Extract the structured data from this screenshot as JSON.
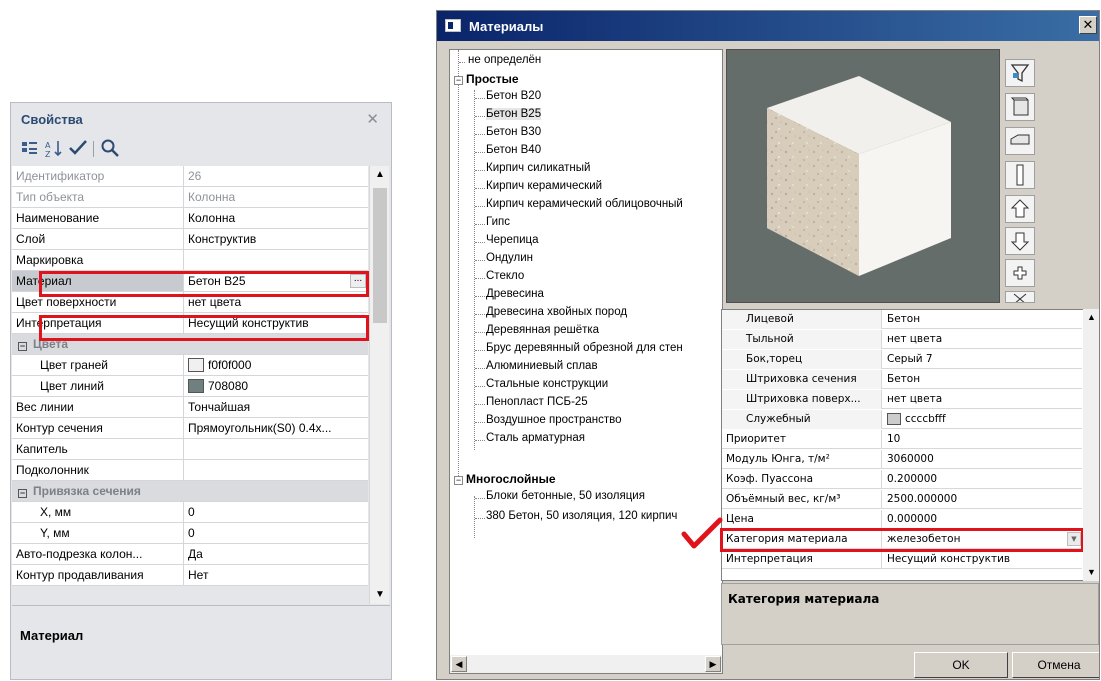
{
  "properties": {
    "title": "Свойства",
    "rows": [
      {
        "name": "Идентификатор",
        "value": "26"
      },
      {
        "name": "Тип объекта",
        "value": "Колонна"
      },
      {
        "name": "Наименование",
        "value": "Колонна"
      },
      {
        "name": "Слой",
        "value": "Конструктив"
      },
      {
        "name": "Маркировка",
        "value": ""
      },
      {
        "name": "Материал",
        "value": "Бетон В25",
        "button": "..."
      },
      {
        "name": "Цвет поверхности",
        "value": "нет цвета"
      },
      {
        "name": "Интерпретация",
        "value": "Несущий конструктив"
      },
      {
        "name": "Цвета",
        "value": "",
        "collapse": "−"
      },
      {
        "name": "Цвет граней",
        "value": "f0f0f000",
        "swatch": "#f0f0f0"
      },
      {
        "name": "Цвет линий",
        "value": "708080",
        "swatch": "#708080"
      },
      {
        "name": "Вес линии",
        "value": "Тончайшая"
      },
      {
        "name": "Контур сечения",
        "value": "Прямоугольник(S0) 0.4x..."
      },
      {
        "name": "Капитель",
        "value": ""
      },
      {
        "name": "Подколонник",
        "value": ""
      },
      {
        "name": "Привязка сечения",
        "value": "",
        "collapse": "−"
      },
      {
        "name": "X, мм",
        "value": "0"
      },
      {
        "name": "Y, мм",
        "value": "0"
      },
      {
        "name": "Авто-подрезка колон...",
        "value": "Да"
      },
      {
        "name": "Контур продавливания",
        "value": "Нет"
      }
    ],
    "description_title": "Материал"
  },
  "materials": {
    "title": "Материалы",
    "tree": {
      "undefined": "не определён",
      "simple_group": "Простые",
      "simple": [
        "Бетон В20",
        "Бетон В25",
        "Бетон В30",
        "Бетон В40",
        "Кирпич силикатный",
        "Кирпич керамический",
        "Кирпич керамический облицовочный",
        "Гипс",
        "Черепица",
        "Ондулин",
        "Стекло",
        "Древесина",
        "Древесина хвойных пород",
        "Деревянная решётка",
        "Брус деревянный обрезной для стен",
        "Алюминиевый сплав",
        "Стальные конструкции",
        "Пенопласт ПСБ-25",
        "Воздушное пространство",
        "Сталь арматурная"
      ],
      "multi_group": "Многослойные",
      "multi": [
        "Блоки бетонные, 50 изоляция",
        "380 Бетон, 50 изоляция, 120 кирпич"
      ]
    },
    "grid": [
      {
        "name": "Лицевой",
        "value": "Бетон",
        "sub": true
      },
      {
        "name": "Тыльной",
        "value": "нет цвета",
        "sub": true
      },
      {
        "name": "Бок,торец",
        "value": "Серый 7",
        "sub": true
      },
      {
        "name": "Штриховка сечения",
        "value": "Бетон",
        "sub": true
      },
      {
        "name": "Штриховка поверх...",
        "value": "нет цвета",
        "sub": true
      },
      {
        "name": "Служебный",
        "value": "ccccbfff",
        "sub": true,
        "swatch": "#cccccb"
      },
      {
        "name": "Приоритет",
        "value": "10"
      },
      {
        "name": "Модуль Юнга, т/м²",
        "value": "3060000"
      },
      {
        "name": "Коэф. Пуассона",
        "value": "0.200000"
      },
      {
        "name": "Объёмный вес, кг/м³",
        "value": "2500.000000"
      },
      {
        "name": "Цена",
        "value": "0.000000"
      },
      {
        "name": "Категория материала",
        "value": "железобетон",
        "dropdown": true
      },
      {
        "name": "Интерпретация",
        "value": "Несущий конструктив"
      }
    ],
    "description_title": "Категория материала",
    "ok": "OK",
    "cancel": "Отмена"
  },
  "colors": {
    "highlight": "#e0121b",
    "title_bar": "#0a246a",
    "preview_bg": "#656d6b"
  }
}
